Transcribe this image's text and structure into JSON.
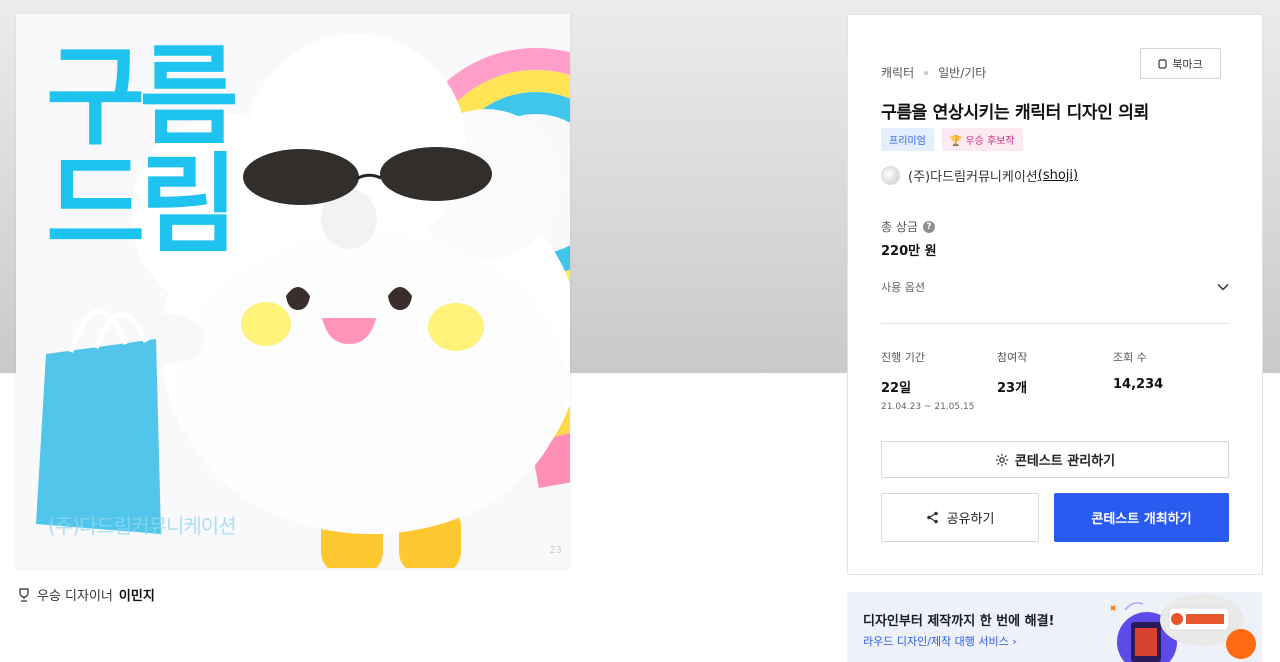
{
  "artwork": {
    "title_line1": "구름",
    "title_line2": "드림",
    "watermark": "(주)다드림커뮤니케이션",
    "corner_mark": "23"
  },
  "designer": {
    "prefix": "우승 디자이너",
    "name": "이민지"
  },
  "contest": {
    "category": "캐릭터",
    "subcategory": "일반/기타",
    "bookmark_label": "북마크",
    "title": "구름을 연상시키는 캐릭터 디자인 의뢰",
    "badges": {
      "premium": "프리미엄",
      "award": "우승 후보작"
    },
    "host_name": "(주)다드림커뮤니케이션",
    "host_handle": "(shoji)",
    "prize_label": "총 상금",
    "prize_value": "220만 원",
    "usage_label": "사용 옵션",
    "stats": {
      "period_label": "진행 기간",
      "period_value": "22일",
      "period_dates": "21.04.23 ~ 21.05.15",
      "participants_label": "참여작",
      "participants_value": "23개",
      "views_label": "조회 수",
      "views_value": "14,234"
    },
    "manage_label": "콘테스트 관리하기",
    "share_label": "공유하기",
    "host_contest_label": "콘테스트 개최하기"
  },
  "banner": {
    "headline": "디자인부터 제작까지 한 번에 해결!",
    "link": "라우드 디자인/제작 대행 서비스 ›"
  },
  "colors": {
    "accent": "#2a5bf0",
    "title_cyan": "#1ec3ef",
    "premium_bg": "#e3eeff",
    "award_bg": "#fde9f2"
  }
}
